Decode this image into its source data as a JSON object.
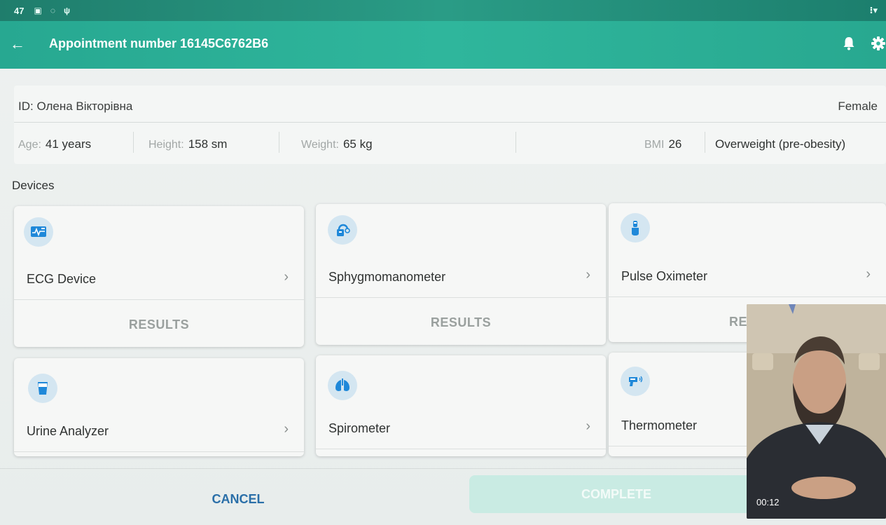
{
  "status_bar": {
    "time": "47"
  },
  "app_bar": {
    "title": "Appointment number 16145C6762B6"
  },
  "patient": {
    "id_label": "ID: Олена Вікторівна",
    "sex": "Female",
    "age_label": "Age:",
    "age_value": "41 years",
    "height_label": "Height:",
    "height_value": "158 sm",
    "weight_label": "Weight:",
    "weight_value": "65 kg",
    "bmi_label": "BMI",
    "bmi_value": "26",
    "bmi_category": "Overweight (pre-obesity)"
  },
  "section": {
    "devices_title": "Devices"
  },
  "devices": [
    {
      "name": "ECG Device",
      "results_label": "RESULTS",
      "icon": "ecg-monitor-icon"
    },
    {
      "name": "Sphygmomanometer",
      "results_label": "RESULTS",
      "icon": "blood-pressure-icon"
    },
    {
      "name": "Pulse Oximeter",
      "results_label": "RESU",
      "icon": "pulse-oximeter-icon"
    },
    {
      "name": "Urine Analyzer",
      "icon": "urine-cup-icon"
    },
    {
      "name": "Spirometer",
      "icon": "lungs-icon"
    },
    {
      "name": "Thermometer",
      "icon": "thermometer-icon"
    }
  ],
  "actions": {
    "cancel": "CANCEL",
    "complete": "COMPLETE"
  },
  "video": {
    "timer": "00:12"
  },
  "colors": {
    "app_bar": "#2fb69c",
    "icon_bg": "#d4e6f1",
    "icon_fg": "#1f88d9",
    "cancel_text": "#2a6fa8",
    "complete_bg": "#c9ebe3"
  }
}
